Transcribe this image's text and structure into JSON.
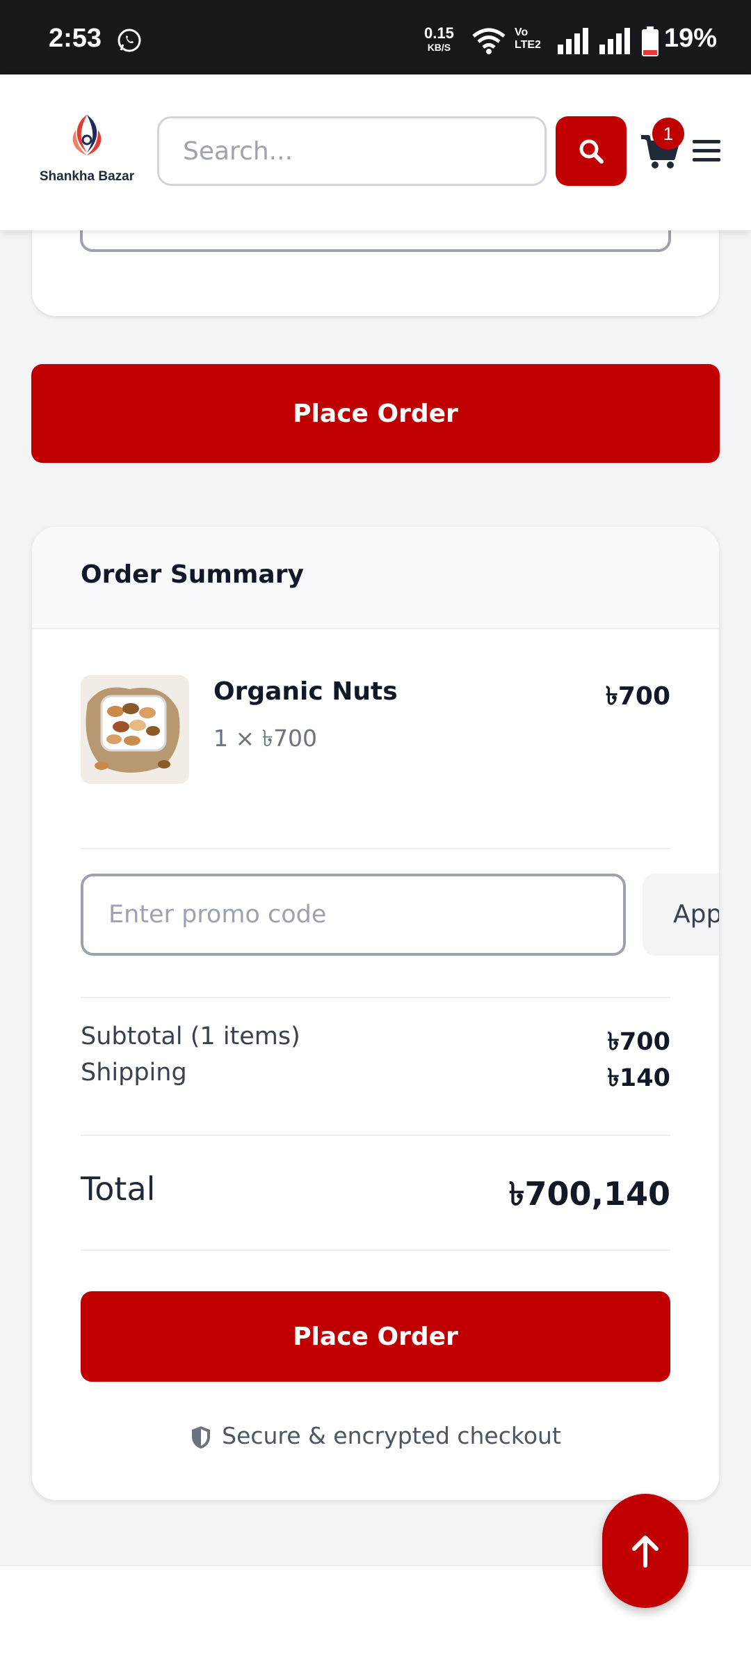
{
  "status_bar": {
    "time": "2:53",
    "speed_value": "0.15",
    "speed_unit": "KB/S",
    "network_label_1": "Vo",
    "network_label_2": "LTE2",
    "battery_percent": "19%"
  },
  "header": {
    "logo_text": "Shankha Bazar",
    "search_placeholder": "Search...",
    "cart_count": "1"
  },
  "actions": {
    "place_order_label": "Place Order"
  },
  "order_summary": {
    "title": "Order Summary",
    "items": [
      {
        "name": "Organic Nuts",
        "qty_line": "1 × ৳700",
        "price": "৳700"
      }
    ],
    "promo_placeholder": "Enter promo code",
    "apply_label": "Apply",
    "subtotal_label": "Subtotal (1 items)",
    "subtotal_value": "৳700",
    "shipping_label": "Shipping",
    "shipping_value": "৳140",
    "total_label": "Total",
    "total_value": "৳700,140",
    "place_order_label": "Place Order",
    "secure_text": "Secure & encrypted checkout"
  },
  "colors": {
    "brand_red": "#c00000",
    "page_bg": "#f3f4f6"
  }
}
